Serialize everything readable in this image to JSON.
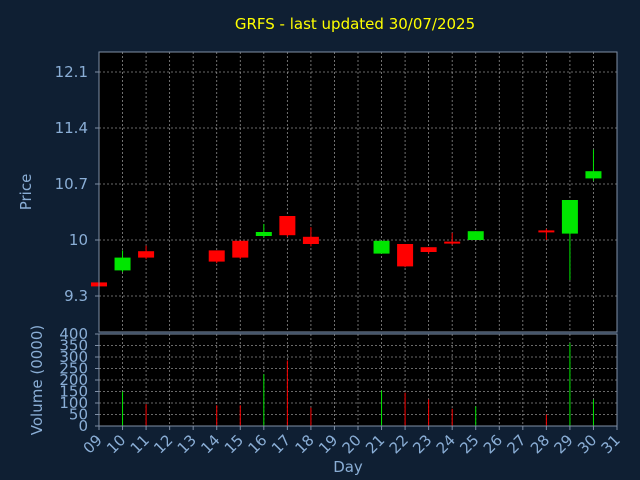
{
  "chart_data": {
    "type": "candlestick",
    "title": "GRFS - last updated 30/07/2025",
    "xlabel": "Day",
    "ylabel_price": "Price",
    "ylabel_volume": "Volume (0000)",
    "x_ticks": [
      "09",
      "10",
      "11",
      "12",
      "13",
      "14",
      "15",
      "16",
      "17",
      "18",
      "19",
      "20",
      "21",
      "22",
      "23",
      "24",
      "25",
      "26",
      "27",
      "28",
      "29",
      "30",
      "31"
    ],
    "x_range": [
      9,
      31
    ],
    "price_ticks": [
      "9.3",
      "10",
      "10.7",
      "11.4",
      "12.1"
    ],
    "price_range": [
      8.85,
      12.35
    ],
    "volume_ticks": [
      "0",
      "50",
      "100",
      "150",
      "200",
      "250",
      "300",
      "350",
      "400"
    ],
    "volume_range": [
      0,
      400
    ],
    "grid": true,
    "colors": {
      "background": "#0f1f33",
      "panel": "#000000",
      "title": "#ffff00",
      "axis_text": "#8aaed6",
      "axis_line": "#7f8fa6",
      "grid": "#c8c8c8",
      "up": "#00e600",
      "down": "#ff0000"
    },
    "candles": [
      {
        "day": 9,
        "open": 9.47,
        "high": 9.47,
        "low": 9.42,
        "close": 9.42,
        "volume": 0
      },
      {
        "day": 10,
        "open": 9.62,
        "high": 9.87,
        "low": 9.6,
        "close": 9.78,
        "volume": 150
      },
      {
        "day": 11,
        "open": 9.86,
        "high": 9.93,
        "low": 9.76,
        "close": 9.78,
        "volume": 95
      },
      {
        "day": 14,
        "open": 9.87,
        "high": 9.87,
        "low": 9.71,
        "close": 9.73,
        "volume": 90
      },
      {
        "day": 15,
        "open": 9.99,
        "high": 9.99,
        "low": 9.76,
        "close": 9.78,
        "volume": 90
      },
      {
        "day": 16,
        "open": 10.05,
        "high": 10.2,
        "low": 10.03,
        "close": 10.1,
        "volume": 225
      },
      {
        "day": 17,
        "open": 10.3,
        "high": 10.3,
        "low": 10.04,
        "close": 10.06,
        "volume": 285
      },
      {
        "day": 18,
        "open": 10.04,
        "high": 10.16,
        "low": 9.92,
        "close": 9.95,
        "volume": 80
      },
      {
        "day": 21,
        "open": 9.83,
        "high": 9.99,
        "low": 9.83,
        "close": 9.99,
        "volume": 155
      },
      {
        "day": 22,
        "open": 9.95,
        "high": 9.95,
        "low": 9.66,
        "close": 9.67,
        "volume": 145
      },
      {
        "day": 23,
        "open": 9.91,
        "high": 9.91,
        "low": 9.83,
        "close": 9.85,
        "volume": 115
      },
      {
        "day": 24,
        "open": 9.98,
        "high": 10.09,
        "low": 9.94,
        "close": 9.96,
        "volume": 75
      },
      {
        "day": 25,
        "open": 10.0,
        "high": 10.11,
        "low": 10.0,
        "close": 10.11,
        "volume": 85
      },
      {
        "day": 28,
        "open": 10.12,
        "high": 10.14,
        "low": 10.0,
        "close": 10.1,
        "volume": 50
      },
      {
        "day": 29,
        "open": 10.08,
        "high": 10.5,
        "low": 9.5,
        "close": 10.5,
        "volume": 360
      },
      {
        "day": 30,
        "open": 10.77,
        "high": 11.13,
        "low": 10.74,
        "close": 10.86,
        "volume": 115
      }
    ]
  }
}
